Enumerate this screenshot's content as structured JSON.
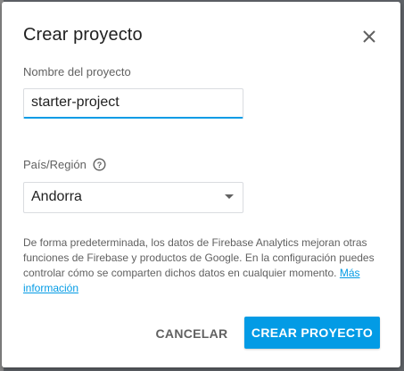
{
  "dialog": {
    "title": "Crear proyecto",
    "close_icon": "close-icon"
  },
  "project_name": {
    "label": "Nombre del proyecto",
    "value": "starter-project"
  },
  "country": {
    "label": "País/Región",
    "help_icon": "help-icon",
    "selected": "Andorra",
    "dropdown_icon": "chevron-down-icon"
  },
  "info": {
    "text": "De forma predeterminada, los datos de Firebase Analytics mejoran otras funciones de Firebase y productos de Google. En la configuración puedes controlar cómo se comparten dichos datos en cualquier momento.",
    "link": "Más información"
  },
  "actions": {
    "cancel": "CANCELAR",
    "create": "CREAR PROYECTO"
  },
  "colors": {
    "accent": "#039be5",
    "title": "#212121",
    "secondary_text": "#616161"
  }
}
